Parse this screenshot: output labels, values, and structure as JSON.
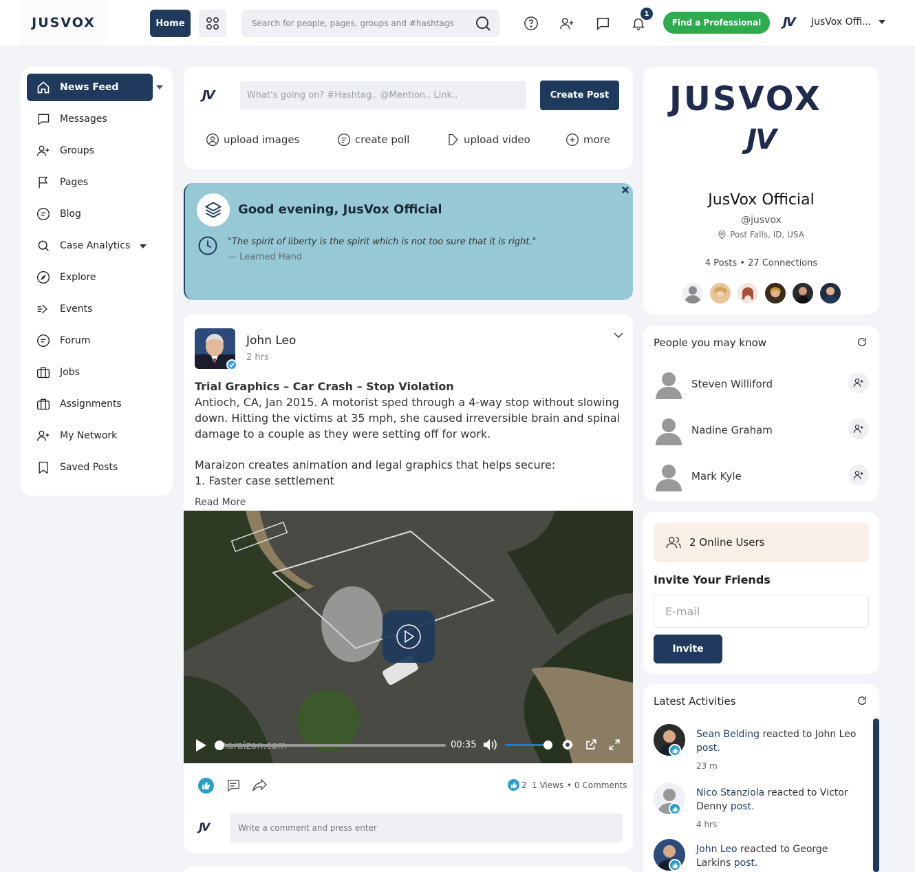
{
  "app": {
    "logo_text": "JUSVOX",
    "user_name": "JusVox Offi...",
    "notification_count": "1"
  },
  "topbar": {
    "home_label": "Home",
    "search_placeholder": "Search for people, pages, groups and #hashtags",
    "find_professional_label": "Find a Professional"
  },
  "sidebar": {
    "items": [
      {
        "label": "News Feed",
        "icon": "home-icon"
      },
      {
        "label": "Messages",
        "icon": "message-icon"
      },
      {
        "label": "Groups",
        "icon": "user-plus-icon"
      },
      {
        "label": "Pages",
        "icon": "flag-icon"
      },
      {
        "label": "Blog",
        "icon": "blog-icon"
      },
      {
        "label": "Case Analytics",
        "icon": "search-icon"
      },
      {
        "label": "Explore",
        "icon": "compass-icon"
      },
      {
        "label": "Events",
        "icon": "events-icon"
      },
      {
        "label": "Forum",
        "icon": "forum-icon"
      },
      {
        "label": "Jobs",
        "icon": "briefcase-icon"
      },
      {
        "label": "Assignments",
        "icon": "briefcase-icon"
      },
      {
        "label": "My Network",
        "icon": "user-plus-icon"
      },
      {
        "label": "Saved Posts",
        "icon": "bookmark-icon"
      }
    ]
  },
  "composer": {
    "placeholder": "What's going on? #Hashtag.. @Mention.. Link..",
    "create_label": "Create Post",
    "actions": [
      "upload images",
      "create poll",
      "upload video",
      "more"
    ]
  },
  "greeting": {
    "title": "Good evening, JusVox Official",
    "quote": "\"The spirit of liberty is the spirit which is not too sure that it is right.\"",
    "author": "— Learned Hand"
  },
  "post": {
    "author": "John Leo",
    "time": "2 hrs",
    "title": "Trial Graphics – Car Crash – Stop Violation",
    "body": "Antioch, CA, Jan 2015. A motorist sped through a 4-way stop without slowing down. Hitting the victims at 35 mph, she caused irreversible brain and spinal damage to a couple as they were setting off for work.",
    "body2": "Maraizon creates animation and legal graphics that helps secure:",
    "body3": "1. Faster case settlement",
    "read_more": "Read More",
    "video_time": "00:35",
    "video_watermark": "maraizon.com",
    "video_progress": 0.0,
    "volume_level": 1.0,
    "likes": "2",
    "views": "1 Views",
    "comments": "• 0 Comments",
    "comment_placeholder": "Write a comment and press enter"
  },
  "profile": {
    "logo_text": "JUSVOX",
    "name": "JusVox Official",
    "handle": "@jusvox",
    "location": "Post Falls, ID, USA",
    "stats": "4 Posts • 27 Connections"
  },
  "suggestions": {
    "title": "People you may know",
    "people": [
      "Steven Williford",
      "Nadine Graham",
      "Mark Kyle"
    ]
  },
  "online": {
    "label": "2 Online Users",
    "invite_title": "Invite Your Friends",
    "email_placeholder": "E-mail",
    "invite_label": "Invite"
  },
  "activities": {
    "title": "Latest Activities",
    "items": [
      {
        "actor": "Sean Belding",
        "verb": " reacted to ",
        "target": "John Leo",
        "obj": " post.",
        "time": "23 m"
      },
      {
        "actor": "Nico Stanziola",
        "verb": " reacted to ",
        "target": "Victor Denny",
        "obj": " post.",
        "time": "4 hrs"
      },
      {
        "actor": "John Leo",
        "verb": " reacted to ",
        "target": "George Larkins",
        "obj": " post.",
        "time": ""
      }
    ]
  },
  "colors": {
    "primary": "#1f3a5c",
    "green": "#2eaa4f",
    "greeting_bg": "#96c9d5",
    "accent_teal": "#2aa0c8"
  }
}
